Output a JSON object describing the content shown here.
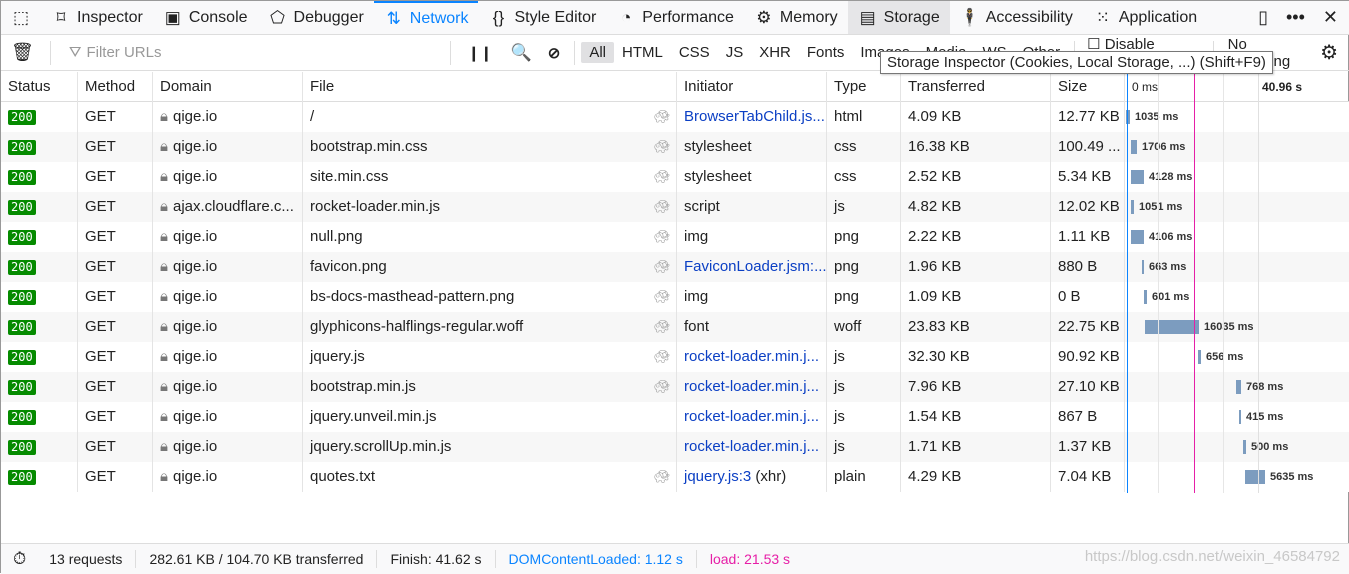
{
  "tabs": [
    {
      "icon": "pick-element-icon",
      "label": ""
    },
    {
      "icon": "inspector-icon",
      "label": "Inspector"
    },
    {
      "icon": "console-icon",
      "label": "Console"
    },
    {
      "icon": "debugger-icon",
      "label": "Debugger"
    },
    {
      "icon": "network-icon",
      "label": "Network",
      "active": true
    },
    {
      "icon": "style-editor-icon",
      "label": "Style Editor"
    },
    {
      "icon": "performance-icon",
      "label": "Performance"
    },
    {
      "icon": "memory-icon",
      "label": "Memory"
    },
    {
      "icon": "storage-icon",
      "label": "Storage",
      "hover": true
    },
    {
      "icon": "accessibility-icon",
      "label": "Accessibility"
    },
    {
      "icon": "application-icon",
      "label": "Application"
    }
  ],
  "toolbar": {
    "filter_placeholder": "Filter URLs",
    "types": [
      "All",
      "HTML",
      "CSS",
      "JS",
      "XHR",
      "Fonts",
      "Images",
      "Media",
      "WS",
      "Other"
    ],
    "selected_type": "All",
    "disable_cache": "Disable Cache",
    "throttling": "No Throttling"
  },
  "tooltip": "Storage Inspector (Cookies, Local Storage, ...) (Shift+F9)",
  "columns": [
    "Status",
    "Method",
    "Domain",
    "File",
    "Initiator",
    "Type",
    "Transferred",
    "Size"
  ],
  "waterfall": {
    "start_label": "0 ms",
    "tick_label": "40.96 s"
  },
  "rows": [
    {
      "status": "200",
      "method": "GET",
      "domain": "qige.io",
      "file": "/",
      "slow": true,
      "initiator": "BrowserTabChild.js...",
      "initiator_link": true,
      "type": "html",
      "transferred": "4.09 KB",
      "size": "12.77 KB",
      "time": "1035 ms"
    },
    {
      "status": "200",
      "method": "GET",
      "domain": "qige.io",
      "file": "bootstrap.min.css",
      "slow": true,
      "initiator": "stylesheet",
      "type": "css",
      "transferred": "16.38 KB",
      "size": "100.49 ...",
      "time": "1706 ms"
    },
    {
      "status": "200",
      "method": "GET",
      "domain": "qige.io",
      "file": "site.min.css",
      "slow": true,
      "initiator": "stylesheet",
      "type": "css",
      "transferred": "2.52 KB",
      "size": "5.34 KB",
      "time": "4128 ms"
    },
    {
      "status": "200",
      "method": "GET",
      "domain": "ajax.cloudflare.c...",
      "file": "rocket-loader.min.js",
      "slow": true,
      "initiator": "script",
      "type": "js",
      "transferred": "4.82 KB",
      "size": "12.02 KB",
      "time": "1051 ms"
    },
    {
      "status": "200",
      "method": "GET",
      "domain": "qige.io",
      "file": "null.png",
      "slow": true,
      "initiator": "img",
      "type": "png",
      "transferred": "2.22 KB",
      "size": "1.11 KB",
      "time": "4106 ms"
    },
    {
      "status": "200",
      "method": "GET",
      "domain": "qige.io",
      "file": "favicon.png",
      "slow": true,
      "initiator": "FaviconLoader.jsm:...",
      "initiator_link": true,
      "type": "png",
      "transferred": "1.96 KB",
      "size": "880 B",
      "time": "663 ms"
    },
    {
      "status": "200",
      "method": "GET",
      "domain": "qige.io",
      "file": "bs-docs-masthead-pattern.png",
      "slow": true,
      "initiator": "img",
      "type": "png",
      "transferred": "1.09 KB",
      "size": "0 B",
      "time": "601 ms"
    },
    {
      "status": "200",
      "method": "GET",
      "domain": "qige.io",
      "file": "glyphicons-halflings-regular.woff",
      "slow": true,
      "initiator": "font",
      "type": "woff",
      "transferred": "23.83 KB",
      "size": "22.75 KB",
      "time": "16035 ms"
    },
    {
      "status": "200",
      "method": "GET",
      "domain": "qige.io",
      "file": "jquery.js",
      "slow": true,
      "initiator": "rocket-loader.min.j...",
      "initiator_link": true,
      "type": "js",
      "transferred": "32.30 KB",
      "size": "90.92 KB",
      "time": "656 ms"
    },
    {
      "status": "200",
      "method": "GET",
      "domain": "qige.io",
      "file": "bootstrap.min.js",
      "slow": true,
      "initiator": "rocket-loader.min.j...",
      "initiator_link": true,
      "type": "js",
      "transferred": "7.96 KB",
      "size": "27.10 KB",
      "time": "768 ms"
    },
    {
      "status": "200",
      "method": "GET",
      "domain": "qige.io",
      "file": "jquery.unveil.min.js",
      "slow": false,
      "initiator": "rocket-loader.min.j...",
      "initiator_link": true,
      "type": "js",
      "transferred": "1.54 KB",
      "size": "867 B",
      "time": "415 ms"
    },
    {
      "status": "200",
      "method": "GET",
      "domain": "qige.io",
      "file": "jquery.scrollUp.min.js",
      "slow": false,
      "initiator": "rocket-loader.min.j...",
      "initiator_link": true,
      "type": "js",
      "transferred": "1.71 KB",
      "size": "1.37 KB",
      "time": "500 ms"
    },
    {
      "status": "200",
      "method": "GET",
      "domain": "qige.io",
      "file": "quotes.txt",
      "slow": true,
      "initiator": "jquery.js:3",
      "initiator_suffix": " (xhr)",
      "initiator_link": true,
      "type": "plain",
      "transferred": "4.29 KB",
      "size": "7.04 KB",
      "time": "5635 ms"
    }
  ],
  "footer": {
    "requests": "13 requests",
    "transferred": "282.61 KB / 104.70 KB transferred",
    "finish": "Finish: 41.62 s",
    "dom": "DOMContentLoaded: 1.12 s",
    "load": "load: 21.53 s"
  },
  "colors": {
    "accent": "#0a84ff",
    "status_ok": "#058b00",
    "dom_line": "#0a84ff",
    "load_line": "#e61fa7",
    "bar": "#7c9cbf"
  },
  "watermark": "https://blog.csdn.net/weixin_46584792"
}
